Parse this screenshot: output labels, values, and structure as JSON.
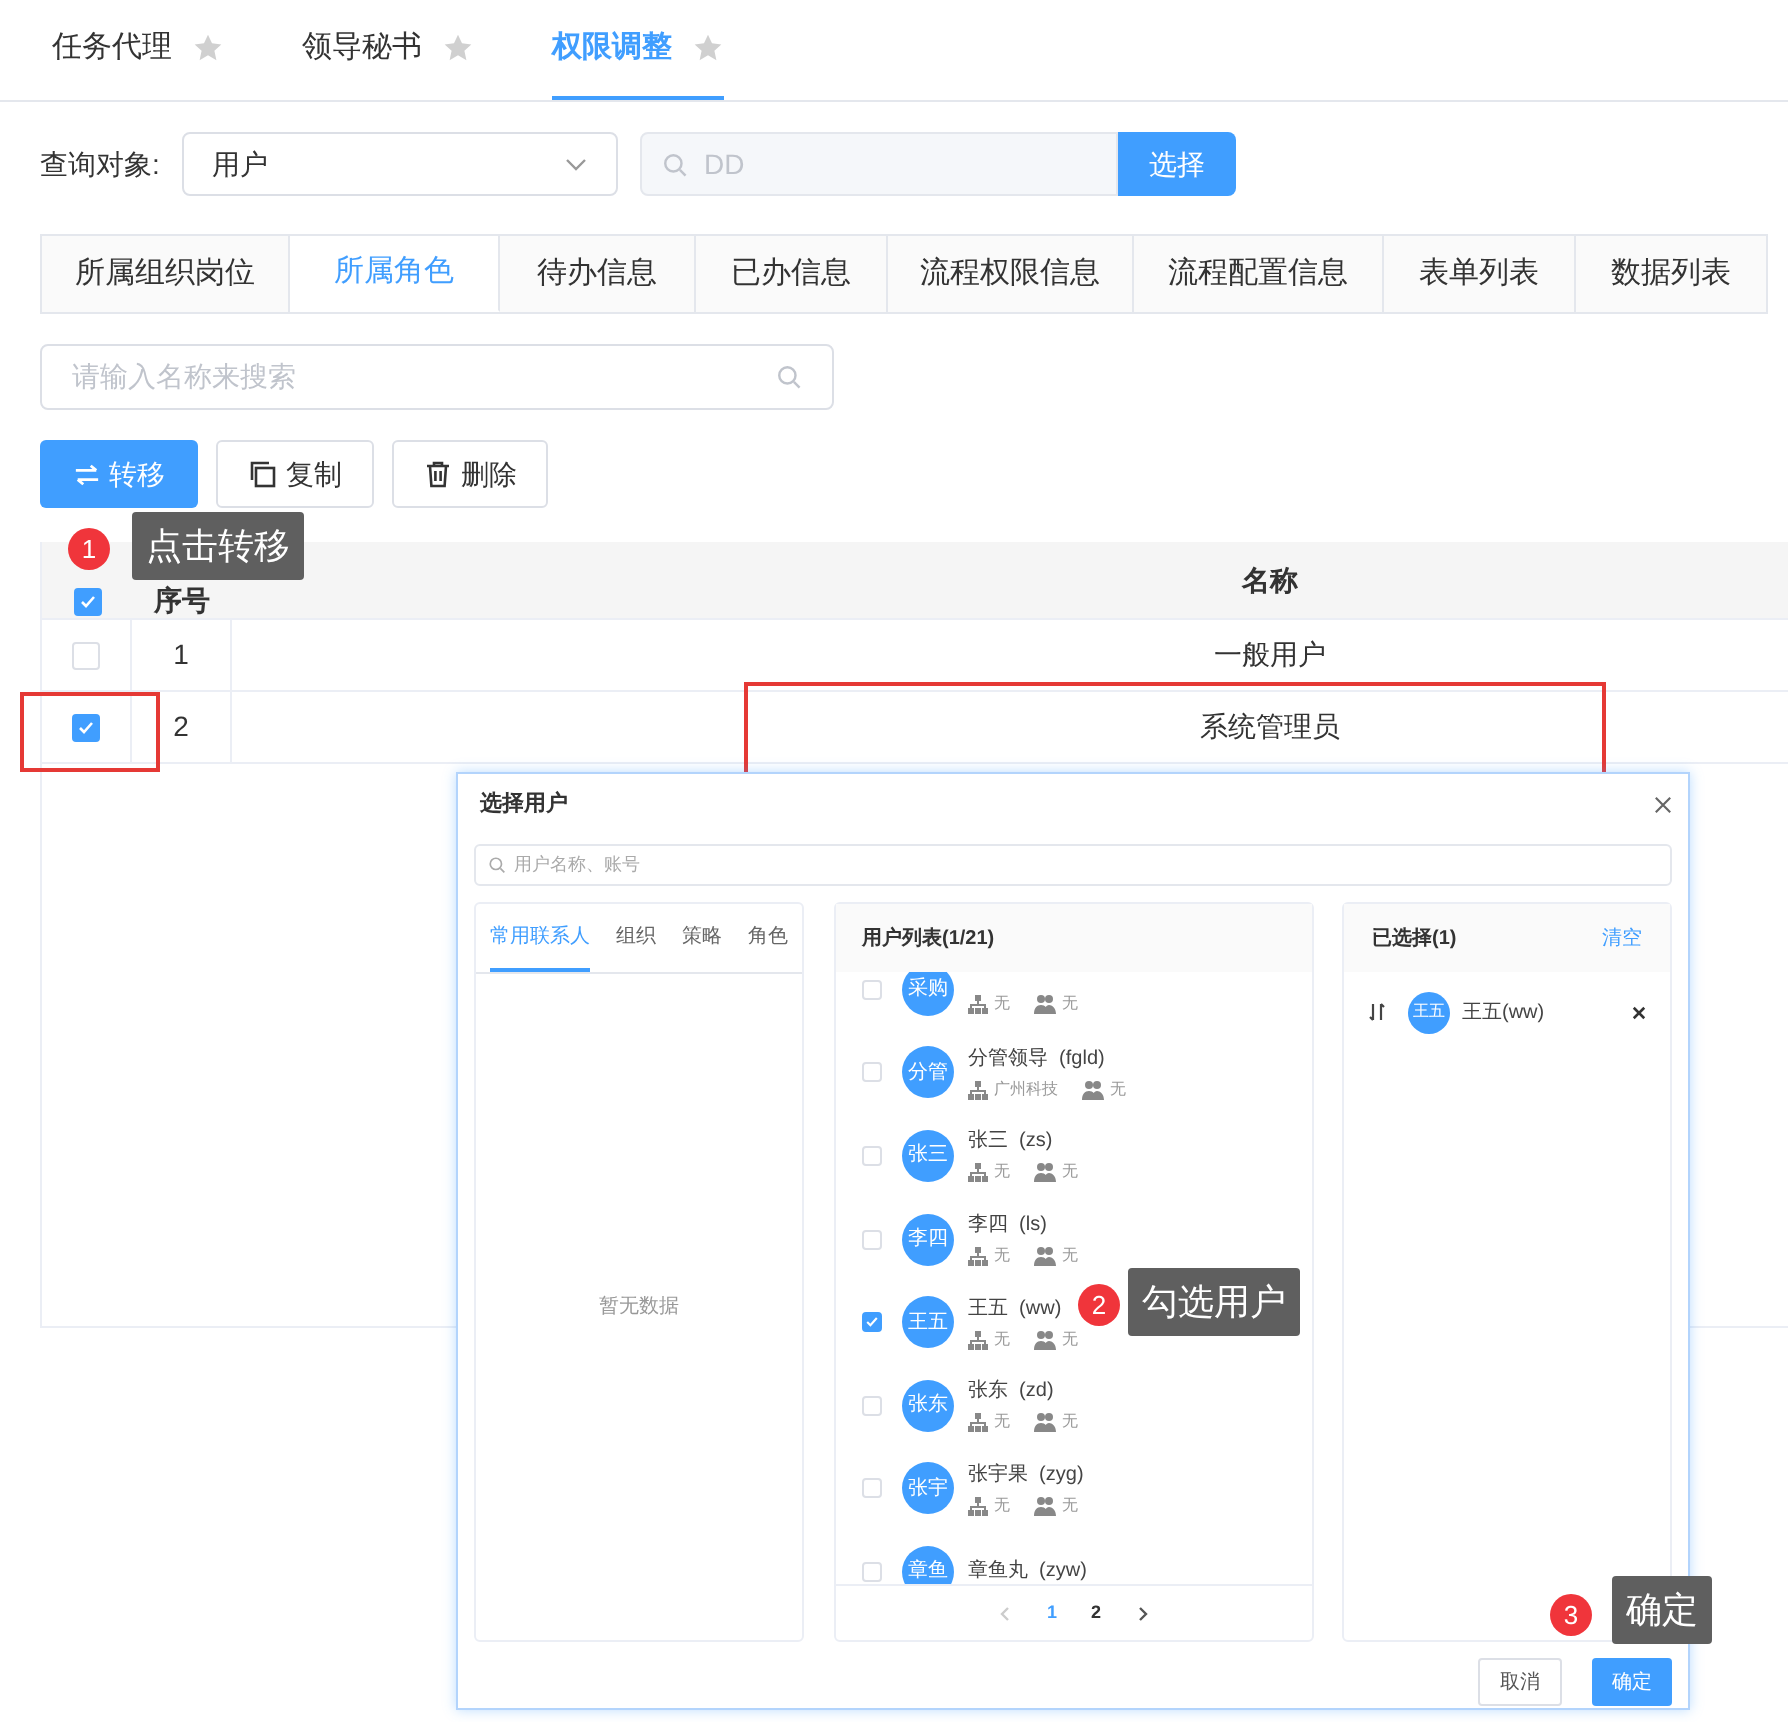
{
  "top_tabs": [
    {
      "label": "任务代理",
      "selected": false
    },
    {
      "label": "领导秘书",
      "selected": false
    },
    {
      "label": "权限调整",
      "selected": true
    }
  ],
  "query": {
    "label": "查询对象:",
    "select_value": "用户",
    "search_value": "DD",
    "button": "选择"
  },
  "section_tabs": [
    {
      "label": "所属组织岗位",
      "selected": false
    },
    {
      "label": "所属角色",
      "selected": true
    },
    {
      "label": "待办信息",
      "selected": false
    },
    {
      "label": "已办信息",
      "selected": false
    },
    {
      "label": "流程权限信息",
      "selected": false
    },
    {
      "label": "流程配置信息",
      "selected": false
    },
    {
      "label": "表单列表",
      "selected": false
    },
    {
      "label": "数据列表",
      "selected": false
    }
  ],
  "search": {
    "placeholder": "请输入名称来搜索"
  },
  "toolbar": [
    {
      "kind": "transfer",
      "label": "转移",
      "primary": true
    },
    {
      "kind": "copy",
      "label": "复制",
      "primary": false
    },
    {
      "kind": "delete",
      "label": "删除",
      "primary": false
    }
  ],
  "table": {
    "columns": [
      "序号",
      "名称"
    ],
    "header_checked": true,
    "rows": [
      {
        "index": "1",
        "name": "一般用户",
        "checked": false
      },
      {
        "index": "2",
        "name": "系统管理员",
        "checked": true
      }
    ]
  },
  "dialog": {
    "title": "选择用户",
    "search_placeholder": "用户名称、账号",
    "source_tabs": [
      {
        "label": "常用联系人",
        "selected": true
      },
      {
        "label": "组织",
        "selected": false
      },
      {
        "label": "策略",
        "selected": false
      },
      {
        "label": "角色",
        "selected": false
      }
    ],
    "empty_text": "暂无数据",
    "user_list": {
      "title": "用户列表(1/21)",
      "users": [
        {
          "avatar": "采购",
          "org": "无",
          "role": "无",
          "checked": false
        },
        {
          "avatar": "分管",
          "name": "分管领导",
          "account": "(fgld)",
          "org": "广州科技",
          "role": "无",
          "checked": false
        },
        {
          "avatar": "张三",
          "name": "张三",
          "account": "(zs)",
          "org": "无",
          "role": "无",
          "checked": false
        },
        {
          "avatar": "李四",
          "name": "李四",
          "account": "(ls)",
          "org": "无",
          "role": "无",
          "checked": false
        },
        {
          "avatar": "王五",
          "name": "王五",
          "account": "(ww)",
          "org": "无",
          "role": "无",
          "checked": true
        },
        {
          "avatar": "张东",
          "name": "张东",
          "account": "(zd)",
          "org": "无",
          "role": "无",
          "checked": false
        },
        {
          "avatar": "张宇",
          "name": "张宇果",
          "account": "(zyg)",
          "org": "无",
          "role": "无",
          "checked": false
        },
        {
          "avatar": "章鱼",
          "name": "章鱼丸",
          "account": "(zyw)",
          "checked": false
        }
      ],
      "pages": [
        {
          "label": "1",
          "selected": true
        },
        {
          "label": "2",
          "selected": false
        }
      ]
    },
    "selected_panel": {
      "title": "已选择(1)",
      "clear": "清空",
      "items": [
        {
          "avatar": "王五",
          "name": "王五(ww)"
        }
      ]
    },
    "buttons": [
      {
        "label": "取消",
        "primary": false
      },
      {
        "label": "确定",
        "primary": true
      }
    ]
  },
  "callouts": [
    {
      "number": "1",
      "text": "点击转移"
    },
    {
      "number": "2",
      "text": "勾选用户"
    },
    {
      "number": "3",
      "text": "确定"
    }
  ]
}
